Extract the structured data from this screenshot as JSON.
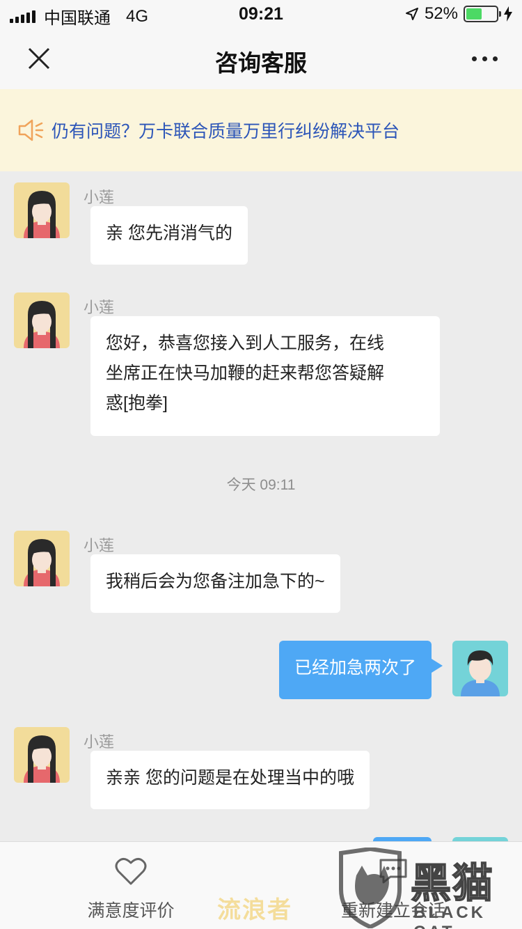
{
  "status_bar": {
    "carrier": "中国联通",
    "network": "4G",
    "time": "09:21",
    "battery_text": "52%",
    "battery_level": 0.52,
    "icons": [
      "signal-icon",
      "location-icon",
      "battery-icon",
      "charging-icon"
    ]
  },
  "nav": {
    "title": "咨询客服",
    "left_icon": "close-icon",
    "right_icon": "more-icon"
  },
  "notice": {
    "icon": "speaker-icon",
    "text": "仍有问题？万卡联合质量万里行纠纷解决平台"
  },
  "messages": [
    {
      "sender": "小莲",
      "text": "亲 您先消消气的"
    },
    {
      "sender": "小莲",
      "lines": [
        "您好，恭喜您接入到人工服务，在线",
        "坐席正在快马加鞭的赶来帮您答疑解",
        "惑[抱拳]"
      ]
    },
    {
      "timestamp": "今天 09:11"
    },
    {
      "sender": "小莲",
      "text": "我稍后会为您备注加急下的~"
    },
    {
      "mine": true,
      "text": "已经加急两次了"
    },
    {
      "sender": "小莲",
      "text": "亲亲 您的问题是在处理当中的哦"
    }
  ],
  "bottom_bar": {
    "rate_label": "满意度评价",
    "rate_icon": "heart-icon",
    "restart_label": "重新建立会话",
    "restart_icon": "chat-bubble-icon"
  },
  "watermarks": {
    "center": "流浪者",
    "logo_cn": "黑猫",
    "logo_en": "BLACK CAT"
  },
  "colors": {
    "accent_blue": "#4ea8f5",
    "notice_bg": "#fbf5dc",
    "notice_text": "#2c55b8",
    "battery_green": "#4cd964"
  }
}
